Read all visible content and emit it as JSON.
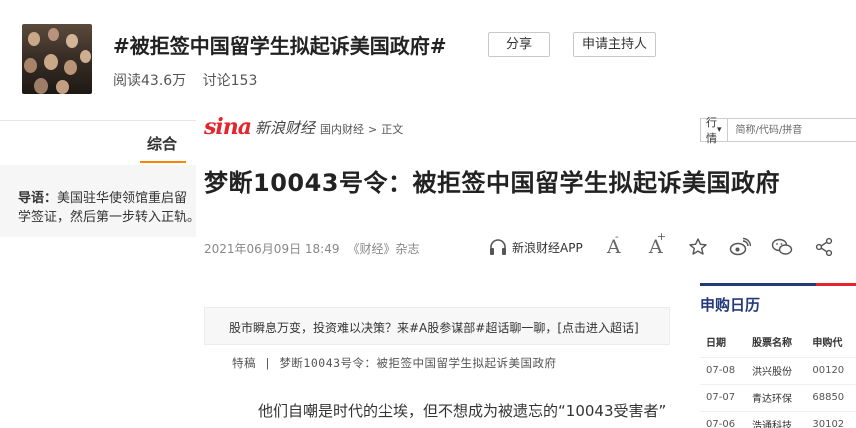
{
  "topic": {
    "title": "#被拒签中国留学生拟起诉美国政府#",
    "share_label": "分享",
    "apply_host_label": "申请主持人",
    "read": "阅读43.6万",
    "discuss": "讨论153",
    "tab": "综合",
    "lead_label": "导语：",
    "lead_text": "美国驻华使领馆重启留学签证，然后第一步转入正轨。"
  },
  "article": {
    "logo_text": "sina",
    "logo_sub": "新浪财经",
    "breadcrumb": [
      "国内财经",
      "正文"
    ],
    "breadcrumb_sep": ">",
    "search": {
      "select": "行情",
      "placeholder": "简称/代码/拼音"
    },
    "headline": "梦断10043号令：被拒签中国留学生拟起诉美国政府",
    "date": "2021年06月09日 18:49",
    "source": "《财经》杂志",
    "app_label": "新浪财经APP",
    "promo": "股市瞬息万变，投资难以决策？来#A股参谋部#超话聊一聊，[点击进入超话]",
    "special_tag": "特稿",
    "special_sep": "|",
    "special_title": "梦断10043号令：被拒签中国留学生拟起诉美国政府",
    "lede": "他们自嘲是时代的尘埃，但不想成为被遗忘的“10043受害者”"
  },
  "ipo": {
    "title": "申购日历",
    "headers": [
      "日期",
      "股票名称",
      "申购代"
    ],
    "rows": [
      {
        "date": "07-08",
        "name": "洪兴股份",
        "code": "00120"
      },
      {
        "date": "07-07",
        "name": "青达环保",
        "code": "68850"
      },
      {
        "date": "07-06",
        "name": "浩通科技",
        "code": "30102"
      }
    ]
  },
  "icons": [
    "headphones-icon",
    "font-decrease-icon",
    "font-increase-icon",
    "star-icon",
    "weibo-icon",
    "wechat-icon",
    "share-icon"
  ]
}
